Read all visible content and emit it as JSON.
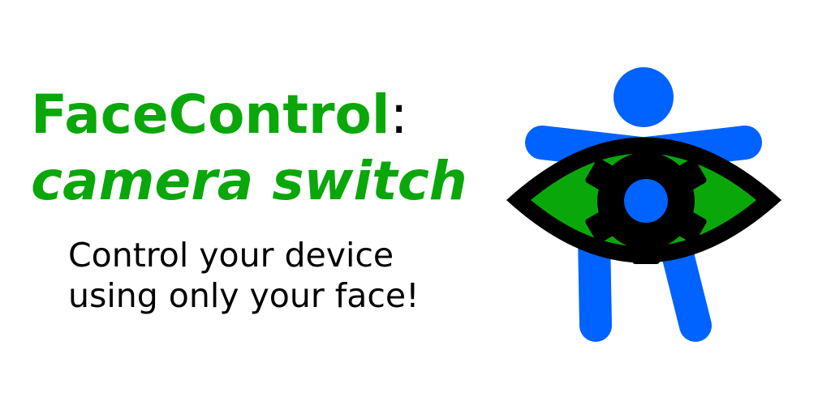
{
  "banner": {
    "title": "FaceControl",
    "title_colon": ":",
    "subtitle": "camera switch",
    "tagline_line1": "Control your device",
    "tagline_line2": "using only your face!"
  },
  "logo": {
    "icon": "facecontrol-logo-icon",
    "figure_color": "#0062ff",
    "iris_color": "#0aa70a",
    "outline_color": "#000000"
  }
}
